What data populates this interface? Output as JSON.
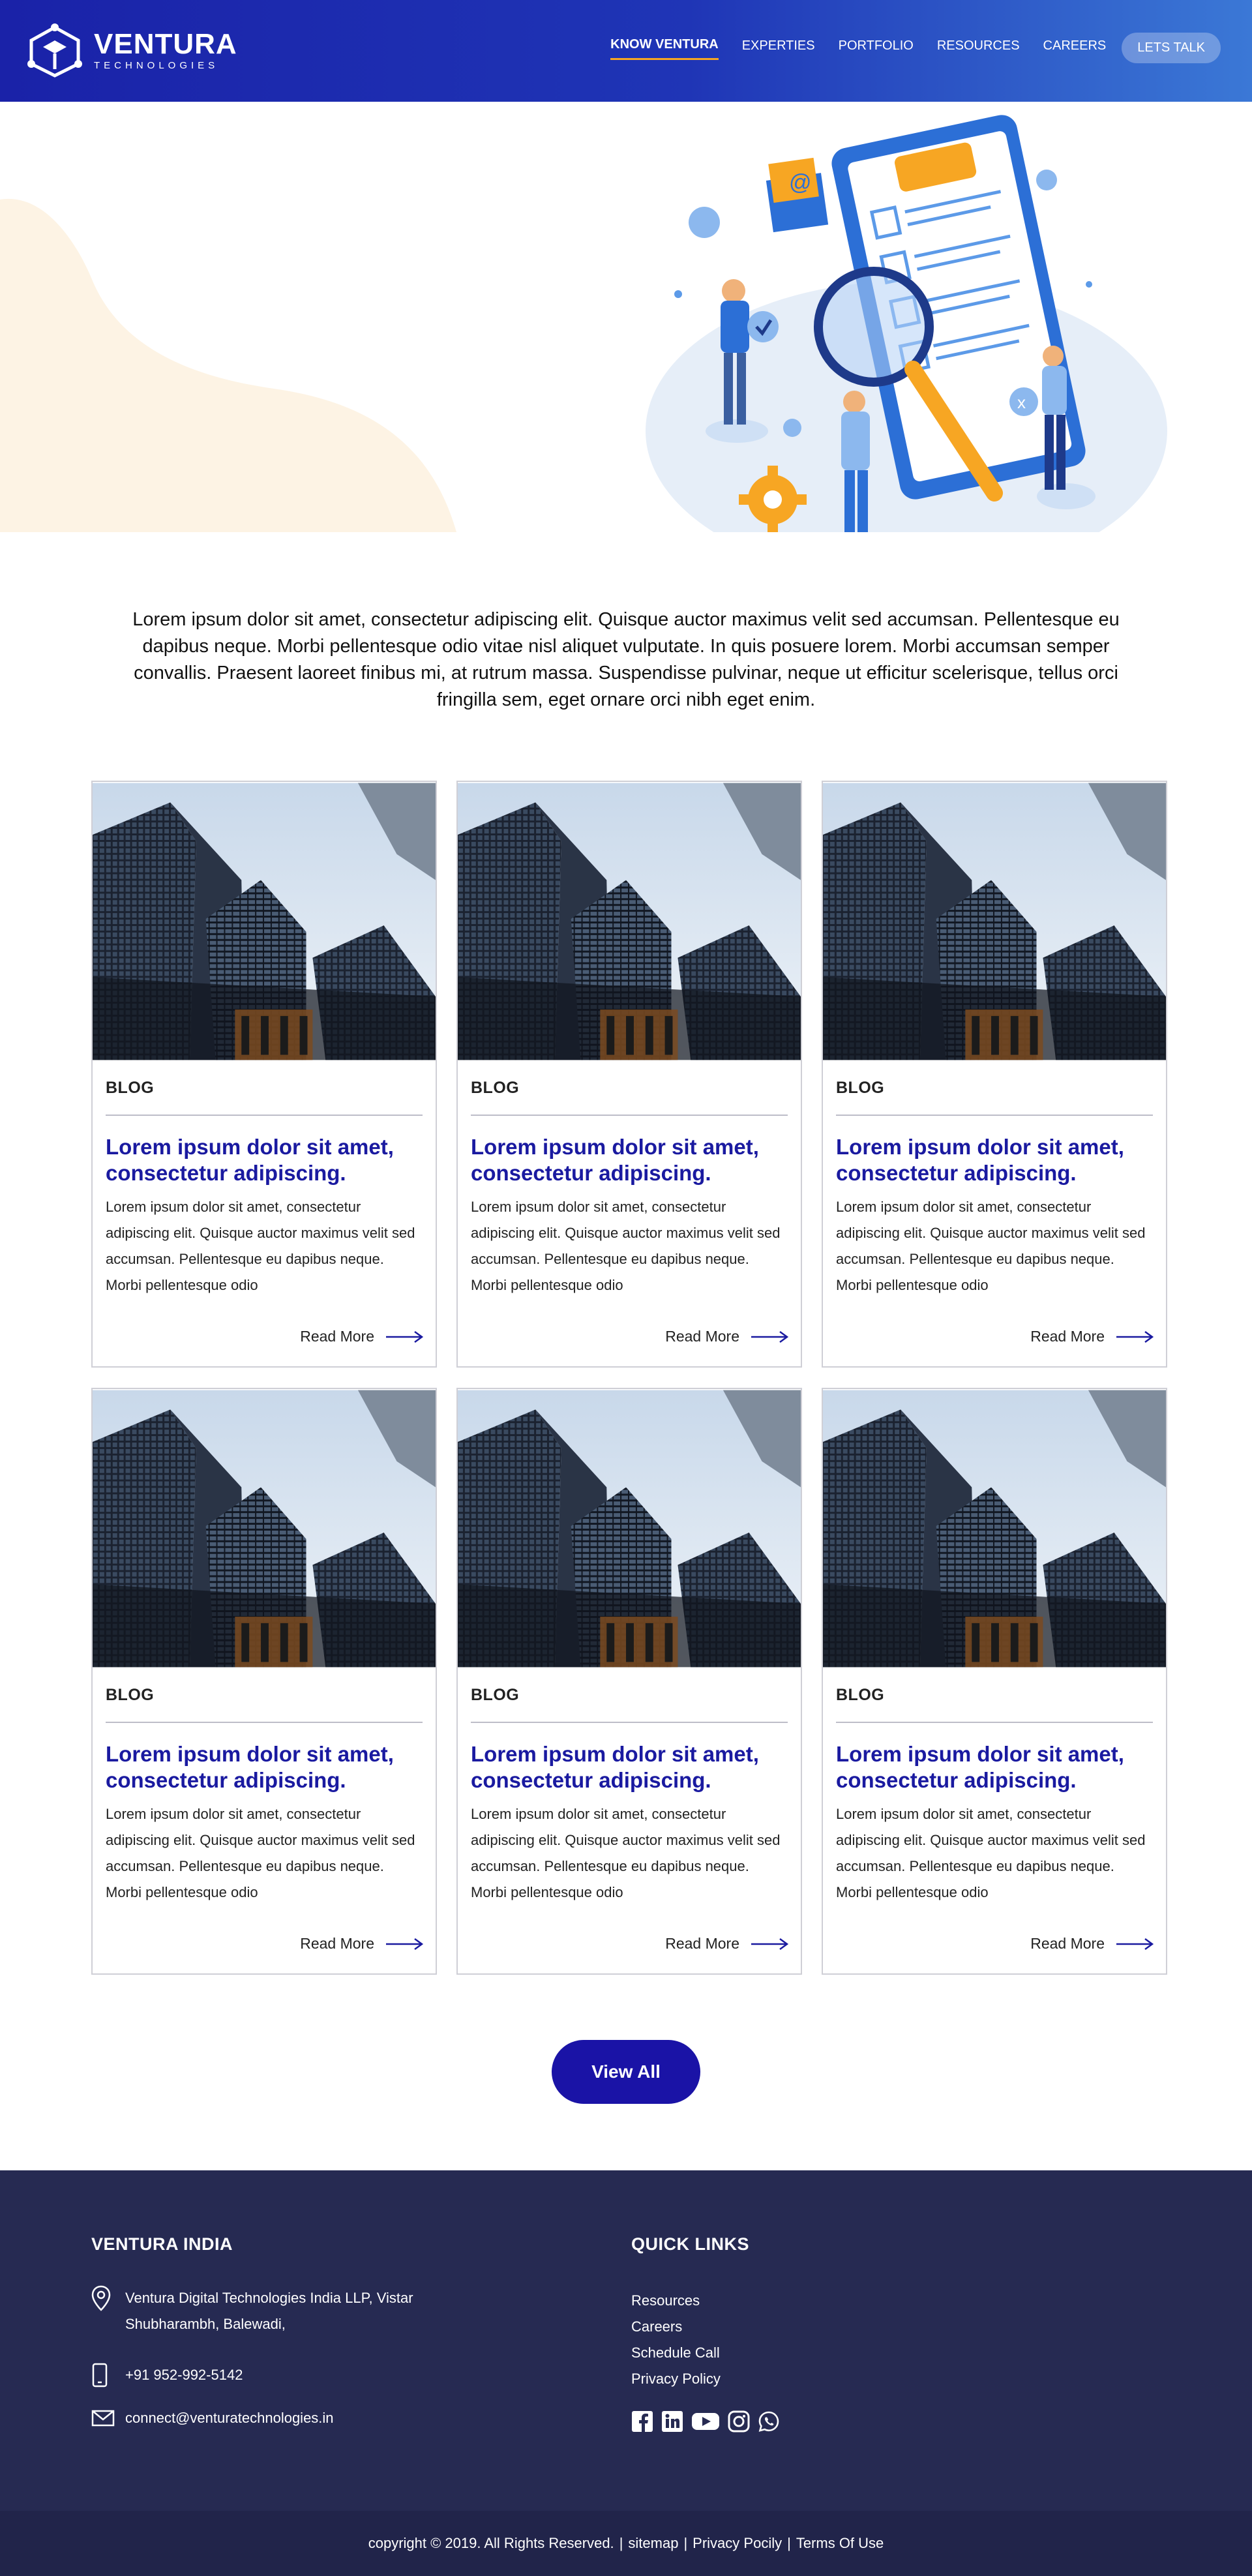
{
  "brand": {
    "name": "VENTURA",
    "tagline": "TECHNOLOGIES"
  },
  "nav": {
    "items": [
      {
        "label": "KNOW VENTURA",
        "active": true
      },
      {
        "label": "EXPERTIES"
      },
      {
        "label": "PORTFOLIO"
      },
      {
        "label": "RESOURCES"
      },
      {
        "label": "CAREERS"
      }
    ],
    "cta": "LETS TALK"
  },
  "intro": {
    "text": "Lorem ipsum dolor sit amet, consectetur adipiscing elit. Quisque auctor maximus velit sed accumsan. Pellentesque eu dapibus neque. Morbi pellentesque odio vitae nisl aliquet vulputate. In quis posuere lorem. Morbi accumsan semper convallis. Praesent laoreet finibus mi, at rutrum massa. Suspendisse pulvinar, neque ut efficitur scelerisque, tellus orci fringilla sem, eget ornare orci nibh eget enim."
  },
  "cards": [
    {
      "category": "BLOG",
      "title": "Lorem ipsum dolor sit amet, consectetur adipiscing.",
      "body": "Lorem ipsum dolor sit amet, consectetur adipiscing elit. Quisque auctor maximus velit sed accumsan. Pellentesque eu dapibus neque. Morbi pellentesque odio",
      "more": "Read More"
    },
    {
      "category": "BLOG",
      "title": "Lorem ipsum dolor sit amet, consectetur adipiscing.",
      "body": "Lorem ipsum dolor sit amet, consectetur adipiscing elit. Quisque auctor maximus velit sed accumsan. Pellentesque eu dapibus neque. Morbi pellentesque odio",
      "more": "Read More"
    },
    {
      "category": "BLOG",
      "title": "Lorem ipsum dolor sit amet, consectetur adipiscing.",
      "body": "Lorem ipsum dolor sit amet, consectetur adipiscing elit. Quisque auctor maximus velit sed accumsan. Pellentesque eu dapibus neque. Morbi pellentesque odio",
      "more": "Read More"
    },
    {
      "category": "BLOG",
      "title": "Lorem ipsum dolor sit amet, consectetur adipiscing.",
      "body": "Lorem ipsum dolor sit amet, consectetur adipiscing elit. Quisque auctor maximus velit sed accumsan. Pellentesque eu dapibus neque. Morbi pellentesque odio",
      "more": "Read More"
    },
    {
      "category": "BLOG",
      "title": "Lorem ipsum dolor sit amet, consectetur adipiscing.",
      "body": "Lorem ipsum dolor sit amet, consectetur adipiscing elit. Quisque auctor maximus velit sed accumsan. Pellentesque eu dapibus neque. Morbi pellentesque odio",
      "more": "Read More"
    },
    {
      "category": "BLOG",
      "title": "Lorem ipsum dolor sit amet, consectetur adipiscing.",
      "body": "Lorem ipsum dolor sit amet, consectetur adipiscing elit. Quisque auctor maximus velit sed accumsan. Pellentesque eu dapibus neque. Morbi pellentesque odio",
      "more": "Read More"
    }
  ],
  "view_all": "View All",
  "footer": {
    "office_heading": "VENTURA INDIA",
    "address_line1": "Ventura Digital Technologies India LLP, Vistar",
    "address_line2": "Shubharambh, Balewadi,",
    "phone": "+91 952-992-5142",
    "email": "connect@venturatechnologies.in",
    "links_heading": "QUICK LINKS",
    "links": [
      "Resources",
      "Careers",
      "Schedule Call",
      "Privacy Policy"
    ],
    "socials": [
      "facebook-icon",
      "linkedin-icon",
      "youtube-icon",
      "instagram-icon",
      "whatsapp-icon"
    ]
  },
  "bottom": {
    "copyright": "copyright © 2019. All Rights Reserved.",
    "sitemap": "sitemap",
    "privacy": "Privacy Pocily",
    "terms": "Terms Of Use"
  },
  "colors": {
    "header_start": "#1a22a8",
    "header_end": "#3b78d6",
    "accent": "#f5a623",
    "title_blue": "#1a1aa0",
    "button": "#1a13a6",
    "footer": "#262a52"
  }
}
